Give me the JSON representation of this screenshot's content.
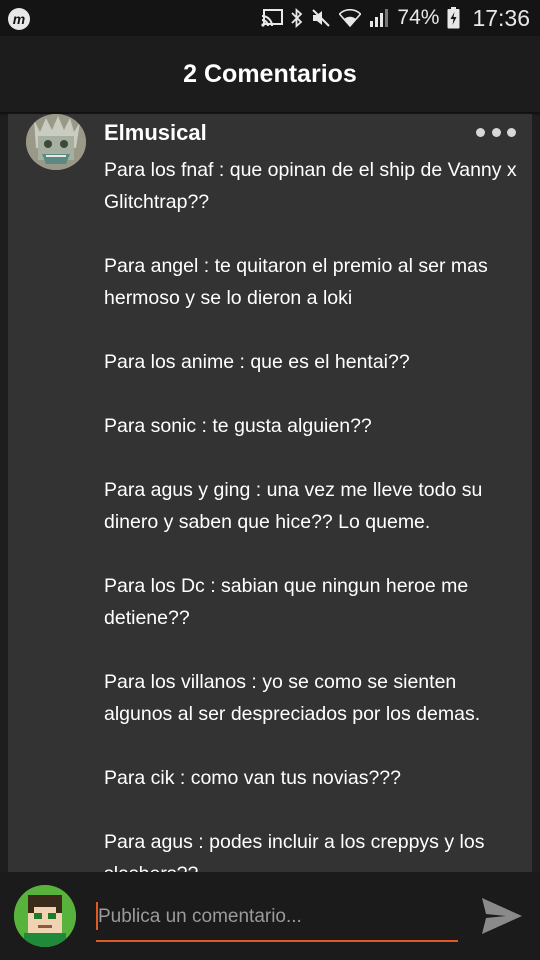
{
  "status_bar": {
    "app_badge": "m",
    "battery_percent": "74%",
    "time": "17:36",
    "icons": [
      "cast-icon",
      "bluetooth-icon",
      "mute-icon",
      "wifi-icon",
      "signal-icon",
      "battery-icon"
    ]
  },
  "header": {
    "title": "2 Comentarios"
  },
  "comment": {
    "author": "Elmusical",
    "paragraphs": [
      "Para los fnaf : que opinan de el ship de Vanny x Glitchtrap??",
      "Para angel : te quitaron el premio al ser mas hermoso y se lo dieron a loki",
      "Para los anime : que es el hentai??",
      "Para sonic : te gusta alguien??",
      "Para agus y ging : una vez me lleve todo su dinero y saben que hice?? Lo queme.",
      "Para los Dc : sabian que ningun heroe me detiene??",
      "Para los villanos : yo se como se sienten algunos al ser despreciados por los demas.",
      "Para cik : como van tus novias???",
      "Para agus : podes incluir a los creppys y los slashers??"
    ]
  },
  "composer": {
    "placeholder": "Publica un comentario...",
    "value": ""
  },
  "colors": {
    "accent": "#e05a28",
    "card_bg": "#333333",
    "page_bg": "#1e1e1e"
  }
}
